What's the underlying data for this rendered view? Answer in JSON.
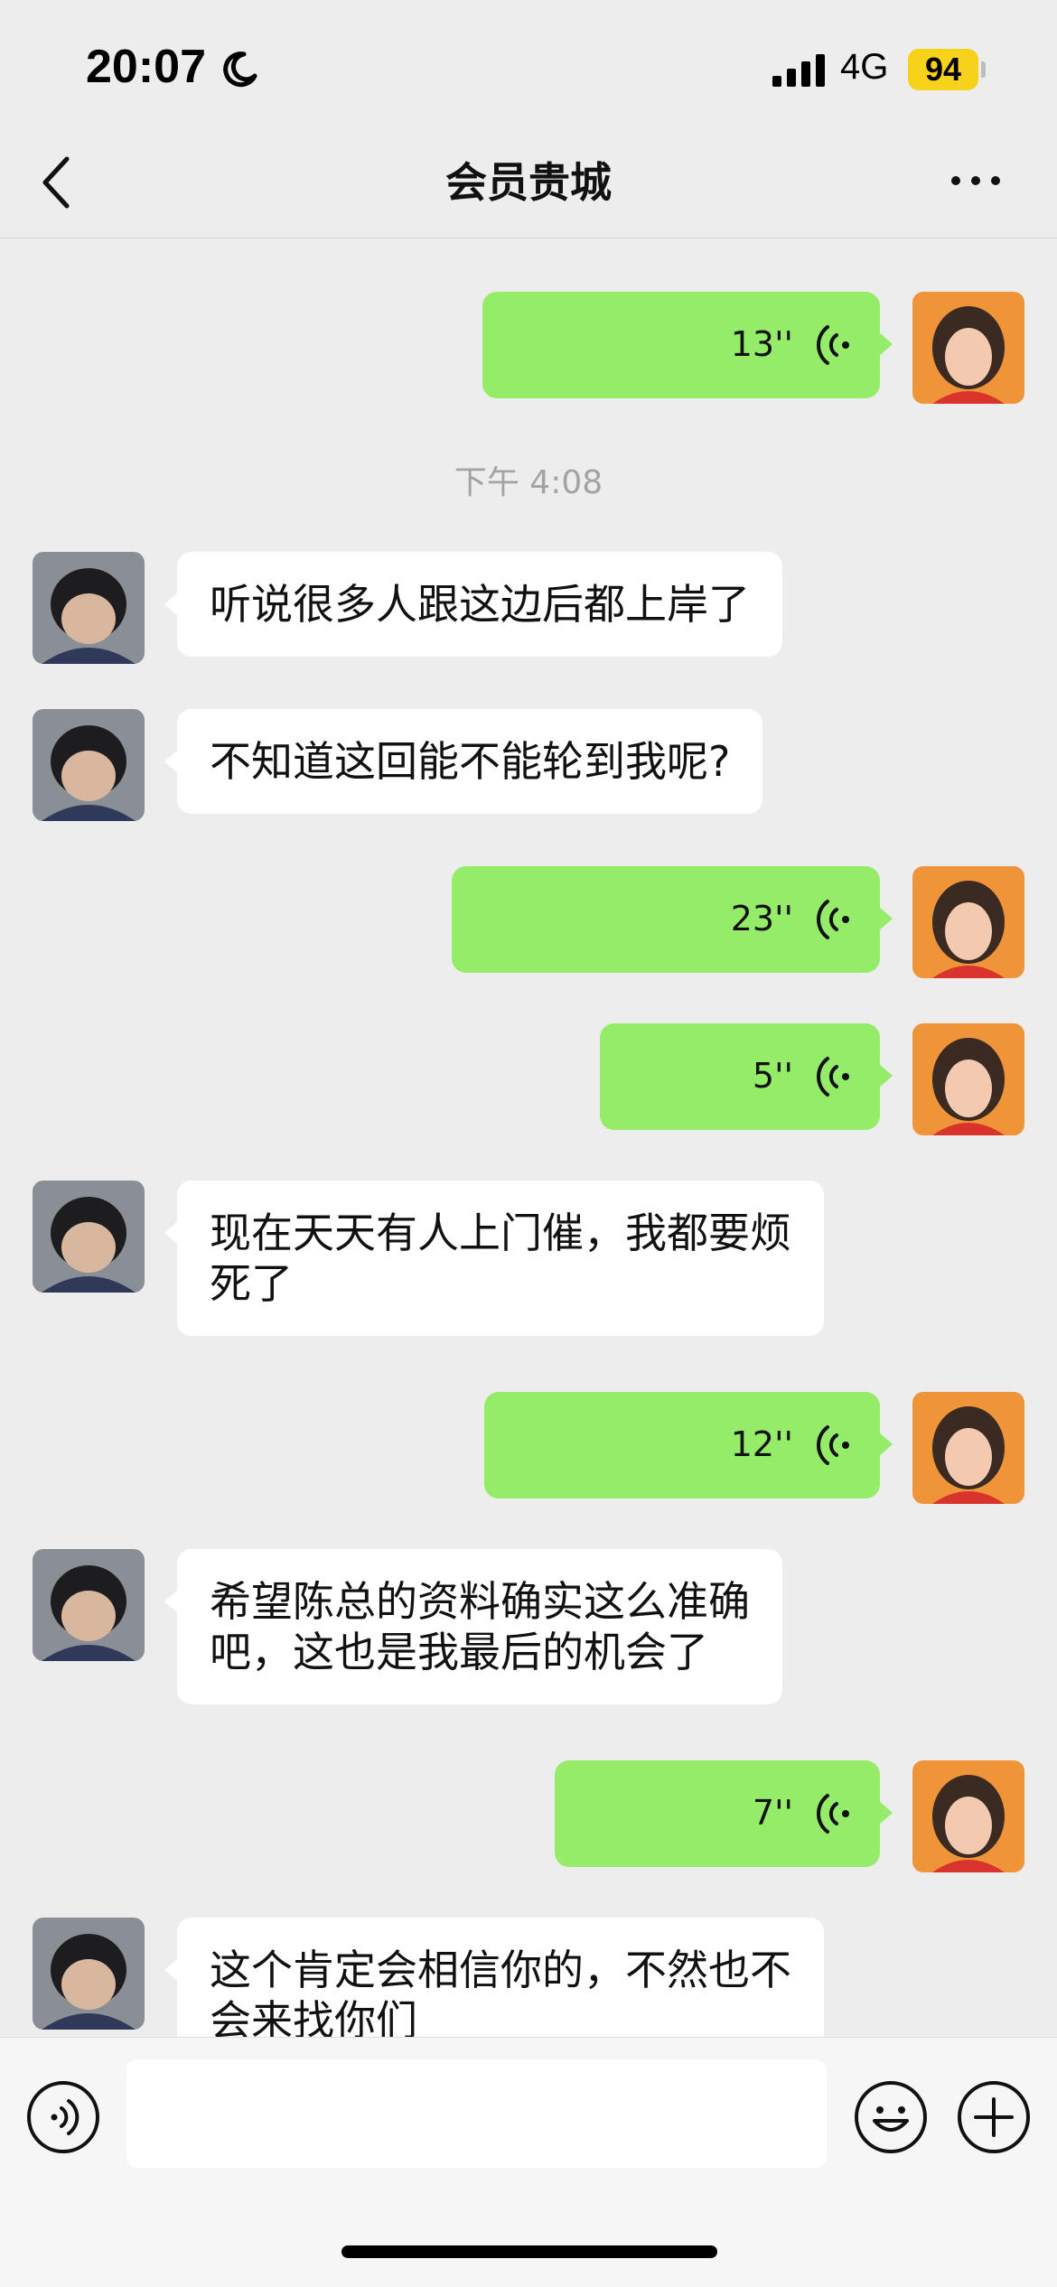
{
  "status_bar": {
    "time": "20:07",
    "network": "4G",
    "battery": "94",
    "icons": [
      "moon-icon",
      "signal-icon",
      "battery-icon"
    ]
  },
  "nav": {
    "title": "会员贵城",
    "back_icon": "chevron-left-icon",
    "more_icon": "more-dots-icon"
  },
  "messages": [
    {
      "side": "self",
      "type": "voice",
      "duration": "13''"
    },
    {
      "type": "timestamp",
      "text": "下午 4:08"
    },
    {
      "side": "other",
      "type": "text",
      "text": "听说很多人跟这边后都上岸了"
    },
    {
      "side": "other",
      "type": "text",
      "text": "不知道这回能不能轮到我呢?"
    },
    {
      "side": "self",
      "type": "voice",
      "duration": "23''"
    },
    {
      "side": "self",
      "type": "voice",
      "duration": "5''"
    },
    {
      "side": "other",
      "type": "text",
      "lines": [
        "现在天天有人上门催，我都要烦",
        "死了"
      ]
    },
    {
      "side": "self",
      "type": "voice",
      "duration": "12''"
    },
    {
      "side": "other",
      "type": "text",
      "lines": [
        "希望陈总的资料确实这么准确",
        "吧，这也是我最后的机会了"
      ]
    },
    {
      "side": "self",
      "type": "voice",
      "duration": "7''"
    },
    {
      "side": "other",
      "type": "text",
      "lines": [
        "这个肯定会相信你的，不然也不",
        "会来找你们"
      ]
    }
  ],
  "input_bar": {
    "placeholder": "",
    "icons": [
      "voice-toggle-icon",
      "emoji-icon",
      "plus-icon"
    ]
  },
  "colors": {
    "background": "#ededed",
    "self_bubble": "#95ec69",
    "other_bubble": "#ffffff",
    "battery": "#f7d21a",
    "timestamp": "#a3a3a3"
  }
}
